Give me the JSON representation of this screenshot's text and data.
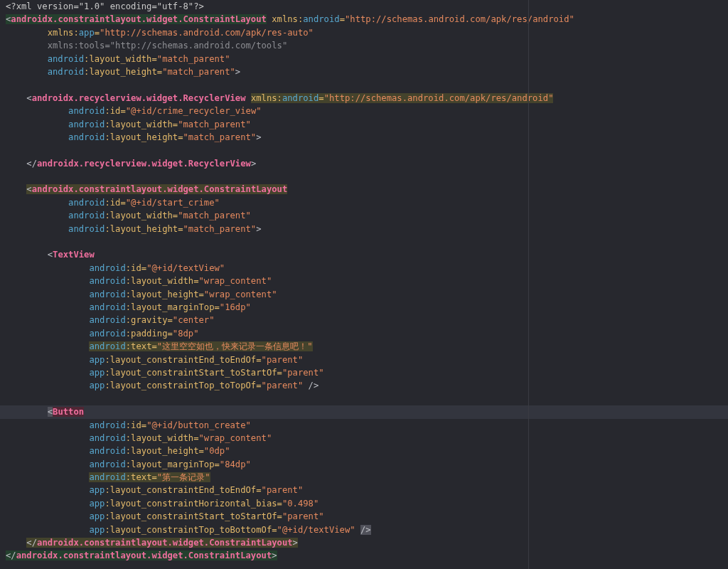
{
  "editor": {
    "lines": [
      {
        "current": false,
        "tokens": [
          {
            "kind": "decl",
            "text": "<?xml version=\"1.0\" encoding=\"utf-8\"?>"
          }
        ]
      },
      {
        "current": false,
        "tokens": [
          {
            "kind": "punct",
            "text": "<",
            "color": "#24402e"
          },
          {
            "kind": "tag",
            "text": "androidx.constraintlayout.widget.ConstraintLayout",
            "color": "#24402e"
          },
          {
            "kind": "attr",
            "text": " xmlns:"
          },
          {
            "kind": "ns",
            "text": "android"
          },
          {
            "kind": "attr",
            "text": "="
          },
          {
            "kind": "value",
            "text": "\"http://schemas.android.com/apk/res/android\""
          }
        ]
      },
      {
        "current": false,
        "tokens": [
          {
            "kind": "attr",
            "text": "        xmlns:"
          },
          {
            "kind": "ns",
            "text": "app"
          },
          {
            "kind": "attr",
            "text": "="
          },
          {
            "kind": "value",
            "text": "\"http://schemas.android.com/apk/res-auto\""
          }
        ]
      },
      {
        "current": false,
        "tokens": [
          {
            "kind": "tools",
            "text": "        xmlns:tools=\"http://schemas.android.com/tools\""
          }
        ]
      },
      {
        "current": false,
        "tokens": [
          {
            "kind": "ns",
            "text": "        android"
          },
          {
            "kind": "attr",
            "text": ":layout_width="
          },
          {
            "kind": "value",
            "text": "\"match_parent\""
          }
        ]
      },
      {
        "current": false,
        "tokens": [
          {
            "kind": "ns",
            "text": "        android"
          },
          {
            "kind": "attr",
            "text": ":layout_height="
          },
          {
            "kind": "value",
            "text": "\"match_parent\""
          },
          {
            "kind": "punct",
            "text": ">"
          }
        ]
      },
      {
        "current": false
      },
      {
        "current": false,
        "tokens": [
          {
            "kind": "punct",
            "text": "    <"
          },
          {
            "kind": "tag",
            "text": "androidx.recyclerview.widget.RecyclerView "
          },
          {
            "kind": "attr",
            "text": "xmlns:",
            "color": "#44432c"
          },
          {
            "kind": "ns",
            "text": "android",
            "color": "#44432c"
          },
          {
            "kind": "attr",
            "text": "=",
            "color": "#44432c"
          },
          {
            "kind": "value",
            "text": "\"http://schemas.android.com/apk/res/android\"",
            "color": "#44432c"
          }
        ]
      },
      {
        "current": false,
        "tokens": [
          {
            "kind": "ns",
            "text": "            android"
          },
          {
            "kind": "attr",
            "text": ":id="
          },
          {
            "kind": "value",
            "text": "\"@+id/crime_recycler_view\""
          }
        ]
      },
      {
        "current": false,
        "tokens": [
          {
            "kind": "ns",
            "text": "            android"
          },
          {
            "kind": "attr",
            "text": ":layout_width="
          },
          {
            "kind": "value",
            "text": "\"match_parent\""
          }
        ]
      },
      {
        "current": false,
        "tokens": [
          {
            "kind": "ns",
            "text": "            android"
          },
          {
            "kind": "attr",
            "text": ":layout_height="
          },
          {
            "kind": "value",
            "text": "\"match_parent\""
          },
          {
            "kind": "punct",
            "text": ">"
          }
        ]
      },
      {
        "current": false
      },
      {
        "current": false,
        "tokens": [
          {
            "kind": "punct",
            "text": "    </"
          },
          {
            "kind": "tag",
            "text": "androidx.recyclerview.widget.RecyclerView"
          },
          {
            "kind": "punct",
            "text": ">"
          }
        ]
      },
      {
        "current": false
      },
      {
        "current": false,
        "tokens": [
          {
            "kind": "punct",
            "text": "    <",
            "color": "#44432c"
          },
          {
            "kind": "tag",
            "text": "androidx.constraintlayout.widget.ConstraintLayout",
            "color": "#44432c"
          }
        ]
      },
      {
        "current": false,
        "tokens": [
          {
            "kind": "ns",
            "text": "            android"
          },
          {
            "kind": "attr",
            "text": ":id="
          },
          {
            "kind": "value",
            "text": "\"@+id/start_crime\""
          }
        ]
      },
      {
        "current": false,
        "tokens": [
          {
            "kind": "ns",
            "text": "            android"
          },
          {
            "kind": "attr",
            "text": ":layout_width="
          },
          {
            "kind": "value",
            "text": "\"match_parent\""
          }
        ]
      },
      {
        "current": false,
        "tokens": [
          {
            "kind": "ns",
            "text": "            android"
          },
          {
            "kind": "attr",
            "text": ":layout_height="
          },
          {
            "kind": "value",
            "text": "\"match_parent\""
          },
          {
            "kind": "punct",
            "text": ">"
          }
        ]
      },
      {
        "current": false
      },
      {
        "current": false,
        "tokens": [
          {
            "kind": "punct",
            "text": "        <"
          },
          {
            "kind": "tag",
            "text": "TextView"
          }
        ]
      },
      {
        "current": false,
        "tokens": [
          {
            "kind": "ns",
            "text": "                android"
          },
          {
            "kind": "attr",
            "text": ":id="
          },
          {
            "kind": "value",
            "text": "\"@+id/textView\""
          }
        ]
      },
      {
        "current": false,
        "tokens": [
          {
            "kind": "ns",
            "text": "                android"
          },
          {
            "kind": "attr",
            "text": ":layout_width="
          },
          {
            "kind": "value",
            "text": "\"wrap_content\""
          }
        ]
      },
      {
        "current": false,
        "tokens": [
          {
            "kind": "ns",
            "text": "                android"
          },
          {
            "kind": "attr",
            "text": ":layout_height="
          },
          {
            "kind": "value",
            "text": "\"wrap_content\""
          }
        ]
      },
      {
        "current": false,
        "tokens": [
          {
            "kind": "ns",
            "text": "                android"
          },
          {
            "kind": "attr",
            "text": ":layout_marginTop="
          },
          {
            "kind": "value",
            "text": "\"16dp\""
          }
        ]
      },
      {
        "current": false,
        "tokens": [
          {
            "kind": "ns",
            "text": "                android"
          },
          {
            "kind": "attr",
            "text": ":gravity="
          },
          {
            "kind": "value",
            "text": "\"center\""
          }
        ]
      },
      {
        "current": false,
        "tokens": [
          {
            "kind": "ns",
            "text": "                android"
          },
          {
            "kind": "attr",
            "text": ":padding="
          },
          {
            "kind": "value",
            "text": "\"8dp\""
          }
        ]
      },
      {
        "current": false,
        "tokens": [
          {
            "kind": "ns",
            "text": "                android",
            "color": "#44432c"
          },
          {
            "kind": "attr",
            "text": ":text=",
            "color": "#44432c"
          },
          {
            "kind": "value",
            "text": "\"这里空空如也，快来记录一条信息吧！\"",
            "color": "#44432c"
          }
        ]
      },
      {
        "current": false,
        "tokens": [
          {
            "kind": "ns",
            "text": "                app"
          },
          {
            "kind": "attr",
            "text": ":layout_constraintEnd_toEndOf="
          },
          {
            "kind": "value",
            "text": "\"parent\""
          }
        ]
      },
      {
        "current": false,
        "tokens": [
          {
            "kind": "ns",
            "text": "                app"
          },
          {
            "kind": "attr",
            "text": ":layout_constraintStart_toStartOf="
          },
          {
            "kind": "value",
            "text": "\"parent\""
          }
        ]
      },
      {
        "current": false,
        "tokens": [
          {
            "kind": "ns",
            "text": "                app"
          },
          {
            "kind": "attr",
            "text": ":layout_constraintTop_toTopOf="
          },
          {
            "kind": "value",
            "text": "\"parent\""
          },
          {
            "kind": "punct",
            "text": " />"
          }
        ]
      },
      {
        "current": false
      },
      {
        "current": true,
        "tokens": [
          {
            "kind": "punct",
            "text": "        <",
            "color": "#50515a"
          },
          {
            "kind": "tag",
            "text": "Button",
            "color": "#4f2634"
          }
        ]
      },
      {
        "current": false,
        "tokens": [
          {
            "kind": "ns",
            "text": "                android"
          },
          {
            "kind": "attr",
            "text": ":id="
          },
          {
            "kind": "value",
            "text": "\"@+id/button_create\""
          }
        ]
      },
      {
        "current": false,
        "tokens": [
          {
            "kind": "ns",
            "text": "                android"
          },
          {
            "kind": "attr",
            "text": ":layout_width="
          },
          {
            "kind": "value",
            "text": "\"wrap_content\""
          }
        ]
      },
      {
        "current": false,
        "tokens": [
          {
            "kind": "ns",
            "text": "                android"
          },
          {
            "kind": "attr",
            "text": ":layout_height="
          },
          {
            "kind": "value",
            "text": "\"0dp\""
          }
        ]
      },
      {
        "current": false,
        "tokens": [
          {
            "kind": "ns",
            "text": "                android"
          },
          {
            "kind": "attr",
            "text": ":layout_marginTop="
          },
          {
            "kind": "value",
            "text": "\"84dp\""
          }
        ]
      },
      {
        "current": false,
        "tokens": [
          {
            "kind": "ns",
            "text": "                android",
            "color": "#44432c"
          },
          {
            "kind": "attr",
            "text": ":text=",
            "color": "#44432c"
          },
          {
            "kind": "value",
            "text": "\"第一条记录\"",
            "color": "#44432c"
          }
        ]
      },
      {
        "current": false,
        "tokens": [
          {
            "kind": "ns",
            "text": "                app"
          },
          {
            "kind": "attr",
            "text": ":layout_constraintEnd_toEndOf="
          },
          {
            "kind": "value",
            "text": "\"parent\""
          }
        ]
      },
      {
        "current": false,
        "tokens": [
          {
            "kind": "ns",
            "text": "                app"
          },
          {
            "kind": "attr",
            "text": ":layout_constraintHorizontal_bias="
          },
          {
            "kind": "value",
            "text": "\"0.498\""
          }
        ]
      },
      {
        "current": false,
        "tokens": [
          {
            "kind": "ns",
            "text": "                app"
          },
          {
            "kind": "attr",
            "text": ":layout_constraintStart_toStartOf="
          },
          {
            "kind": "value",
            "text": "\"parent\""
          }
        ]
      },
      {
        "current": false,
        "tokens": [
          {
            "kind": "ns",
            "text": "                app"
          },
          {
            "kind": "attr",
            "text": ":layout_constraintTop_toBottomOf="
          },
          {
            "kind": "value",
            "text": "\"@+id/textView\" "
          },
          {
            "kind": "punct",
            "text": "/>",
            "color": "#50515a"
          }
        ]
      },
      {
        "current": false,
        "tokens": [
          {
            "kind": "punct",
            "text": "    </",
            "color": "#44432c"
          },
          {
            "kind": "tag",
            "text": "androidx.constraintlayout.widget.ConstraintLayout",
            "color": "#44432c"
          },
          {
            "kind": "punct",
            "text": ">",
            "color": "#44432c"
          }
        ]
      },
      {
        "current": false,
        "tokens": [
          {
            "kind": "punct",
            "text": "</",
            "color": "#24402e"
          },
          {
            "kind": "tag",
            "text": "androidx.constraintlayout.widget.ConstraintLayout",
            "color": "#24402e"
          },
          {
            "kind": "punct",
            "text": ">",
            "color": "#24402e"
          }
        ]
      }
    ]
  }
}
